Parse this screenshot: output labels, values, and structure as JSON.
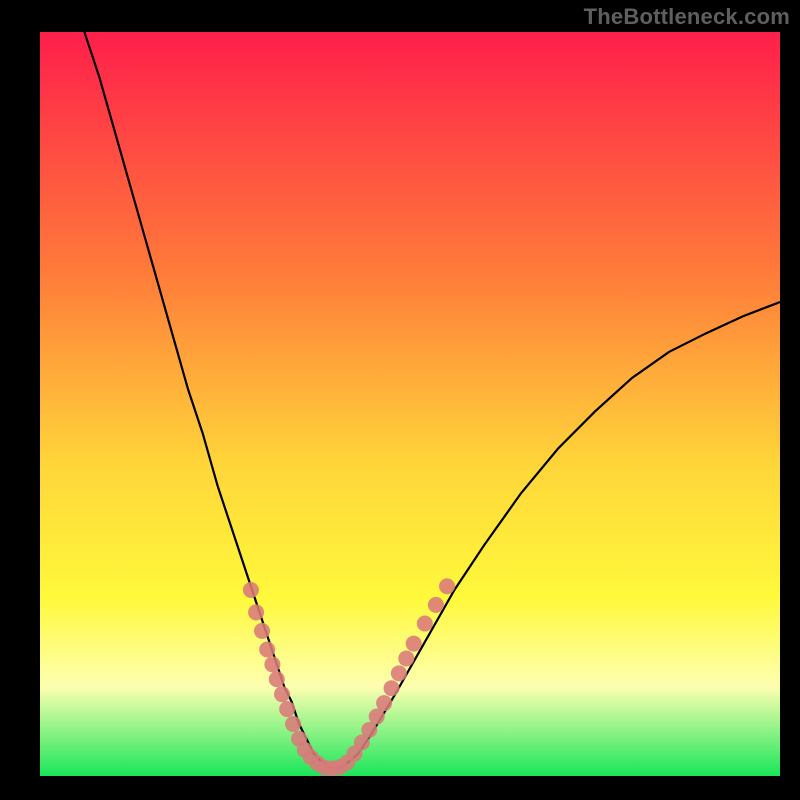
{
  "watermark": "TheBottleneck.com",
  "colors": {
    "bg": "#000000",
    "grad_top": "#ff1f4b",
    "grad_mid1": "#ff7a3a",
    "grad_mid2": "#ffd53a",
    "grad_yellow": "#fff93b",
    "grad_pale": "#fdffb0",
    "grad_green": "#19e65a",
    "curve": "#000000",
    "markers": "#d97a7a"
  },
  "chart_data": {
    "type": "line",
    "title": "",
    "xlabel": "",
    "ylabel": "",
    "xlim": [
      0,
      100
    ],
    "ylim": [
      0,
      100
    ],
    "series": [
      {
        "name": "bottleneck-curve",
        "x": [
          6,
          8,
          10,
          12,
          14,
          16,
          18,
          20,
          22,
          24,
          26,
          28,
          30,
          32,
          33,
          34,
          35,
          36,
          37,
          38,
          39,
          40,
          41,
          43,
          45,
          48,
          52,
          56,
          60,
          65,
          70,
          75,
          80,
          85,
          90,
          95,
          100
        ],
        "y": [
          100,
          94,
          87,
          80,
          73,
          66,
          59,
          52,
          46,
          39,
          33,
          27,
          21,
          15,
          12,
          10,
          7,
          5,
          3,
          2,
          1.2,
          1,
          1.3,
          3,
          6,
          11,
          18,
          25,
          31,
          38,
          44,
          49,
          53.5,
          57,
          59.5,
          61.8,
          63.7
        ]
      }
    ],
    "markers": {
      "name": "highlighted-range",
      "points": [
        {
          "x": 28.5,
          "y": 25
        },
        {
          "x": 29.2,
          "y": 22
        },
        {
          "x": 30.0,
          "y": 19.5
        },
        {
          "x": 30.7,
          "y": 17
        },
        {
          "x": 31.4,
          "y": 15
        },
        {
          "x": 32.0,
          "y": 13
        },
        {
          "x": 32.7,
          "y": 11
        },
        {
          "x": 33.4,
          "y": 9
        },
        {
          "x": 34.2,
          "y": 7
        },
        {
          "x": 35.0,
          "y": 5
        },
        {
          "x": 35.8,
          "y": 3.5
        },
        {
          "x": 36.6,
          "y": 2.5
        },
        {
          "x": 37.5,
          "y": 1.7
        },
        {
          "x": 38.5,
          "y": 1.1
        },
        {
          "x": 39.5,
          "y": 1.0
        },
        {
          "x": 40.5,
          "y": 1.2
        },
        {
          "x": 41.5,
          "y": 1.8
        },
        {
          "x": 42.5,
          "y": 3.0
        },
        {
          "x": 43.5,
          "y": 4.5
        },
        {
          "x": 44.5,
          "y": 6.2
        },
        {
          "x": 45.5,
          "y": 8.0
        },
        {
          "x": 46.5,
          "y": 9.8
        },
        {
          "x": 47.5,
          "y": 11.8
        },
        {
          "x": 48.5,
          "y": 13.8
        },
        {
          "x": 49.5,
          "y": 15.8
        },
        {
          "x": 50.5,
          "y": 17.8
        },
        {
          "x": 52.0,
          "y": 20.5
        },
        {
          "x": 53.5,
          "y": 23.0
        },
        {
          "x": 55.0,
          "y": 25.5
        }
      ]
    }
  }
}
